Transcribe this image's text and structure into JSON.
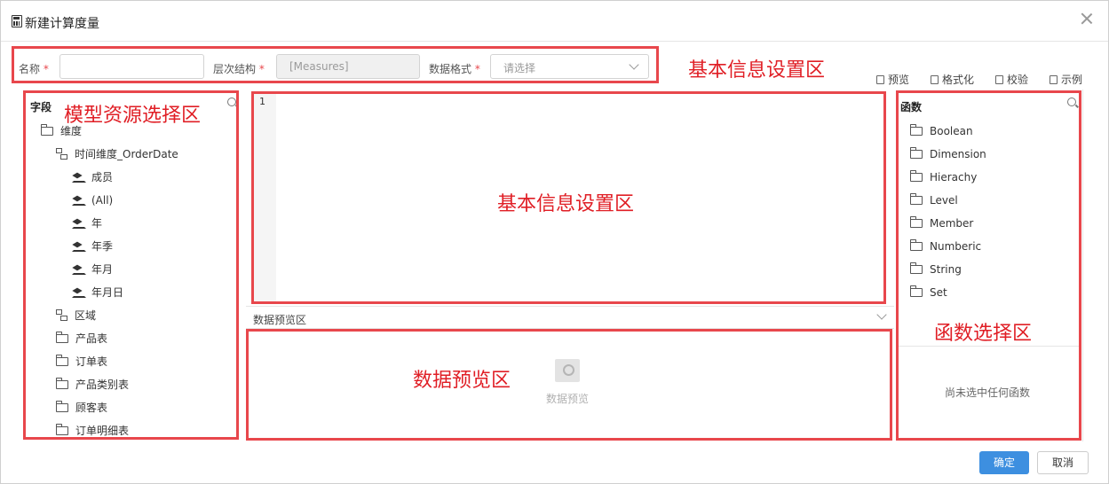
{
  "dialog": {
    "title": "新建计算度量"
  },
  "form": {
    "name_label": "名称",
    "required_mark": "*",
    "name_value": "",
    "hierarchy_label": "层次结构",
    "hierarchy_value": "[Measures]",
    "format_label": "数据格式",
    "format_placeholder": "请选择"
  },
  "toolbar": {
    "preview": "预览",
    "format": "格式化",
    "validate": "校验",
    "example": "示例"
  },
  "annotations": {
    "basic_info": "基本信息设置区",
    "model_resource": "模型资源选择区",
    "editor": "基本信息设置区",
    "data_preview": "数据预览区",
    "function_select": "函数选择区"
  },
  "fields_panel": {
    "title": "字段",
    "items": [
      {
        "label": "维度",
        "icon": "folder-open-icon"
      },
      {
        "label": "时间维度_OrderDate",
        "icon": "hierarchy-icon"
      },
      {
        "label": "成员",
        "icon": "layers-icon"
      },
      {
        "label": "(All)",
        "icon": "layers-icon"
      },
      {
        "label": "年",
        "icon": "layers-icon"
      },
      {
        "label": "年季",
        "icon": "layers-icon"
      },
      {
        "label": "年月",
        "icon": "layers-icon"
      },
      {
        "label": "年月日",
        "icon": "layers-icon"
      },
      {
        "label": "区域",
        "icon": "hierarchy-icon"
      },
      {
        "label": "产品表",
        "icon": "folder-icon"
      },
      {
        "label": "订单表",
        "icon": "folder-icon"
      },
      {
        "label": "产品类别表",
        "icon": "folder-icon"
      },
      {
        "label": "顾客表",
        "icon": "folder-icon"
      },
      {
        "label": "订单明细表",
        "icon": "folder-icon"
      }
    ]
  },
  "editor": {
    "line_number": "1"
  },
  "preview": {
    "bar_label": "数据预览区",
    "empty_text": "数据预览"
  },
  "functions_panel": {
    "title": "函数",
    "items": [
      "Boolean",
      "Dimension",
      "Hierachy",
      "Level",
      "Member",
      "Numberic",
      "String",
      "Set"
    ],
    "empty_text": "尚未选中任何函数"
  },
  "buttons": {
    "ok": "确定",
    "cancel": "取消"
  },
  "colors": {
    "annotation": "#e8474c",
    "primary": "#3d8fe0"
  }
}
